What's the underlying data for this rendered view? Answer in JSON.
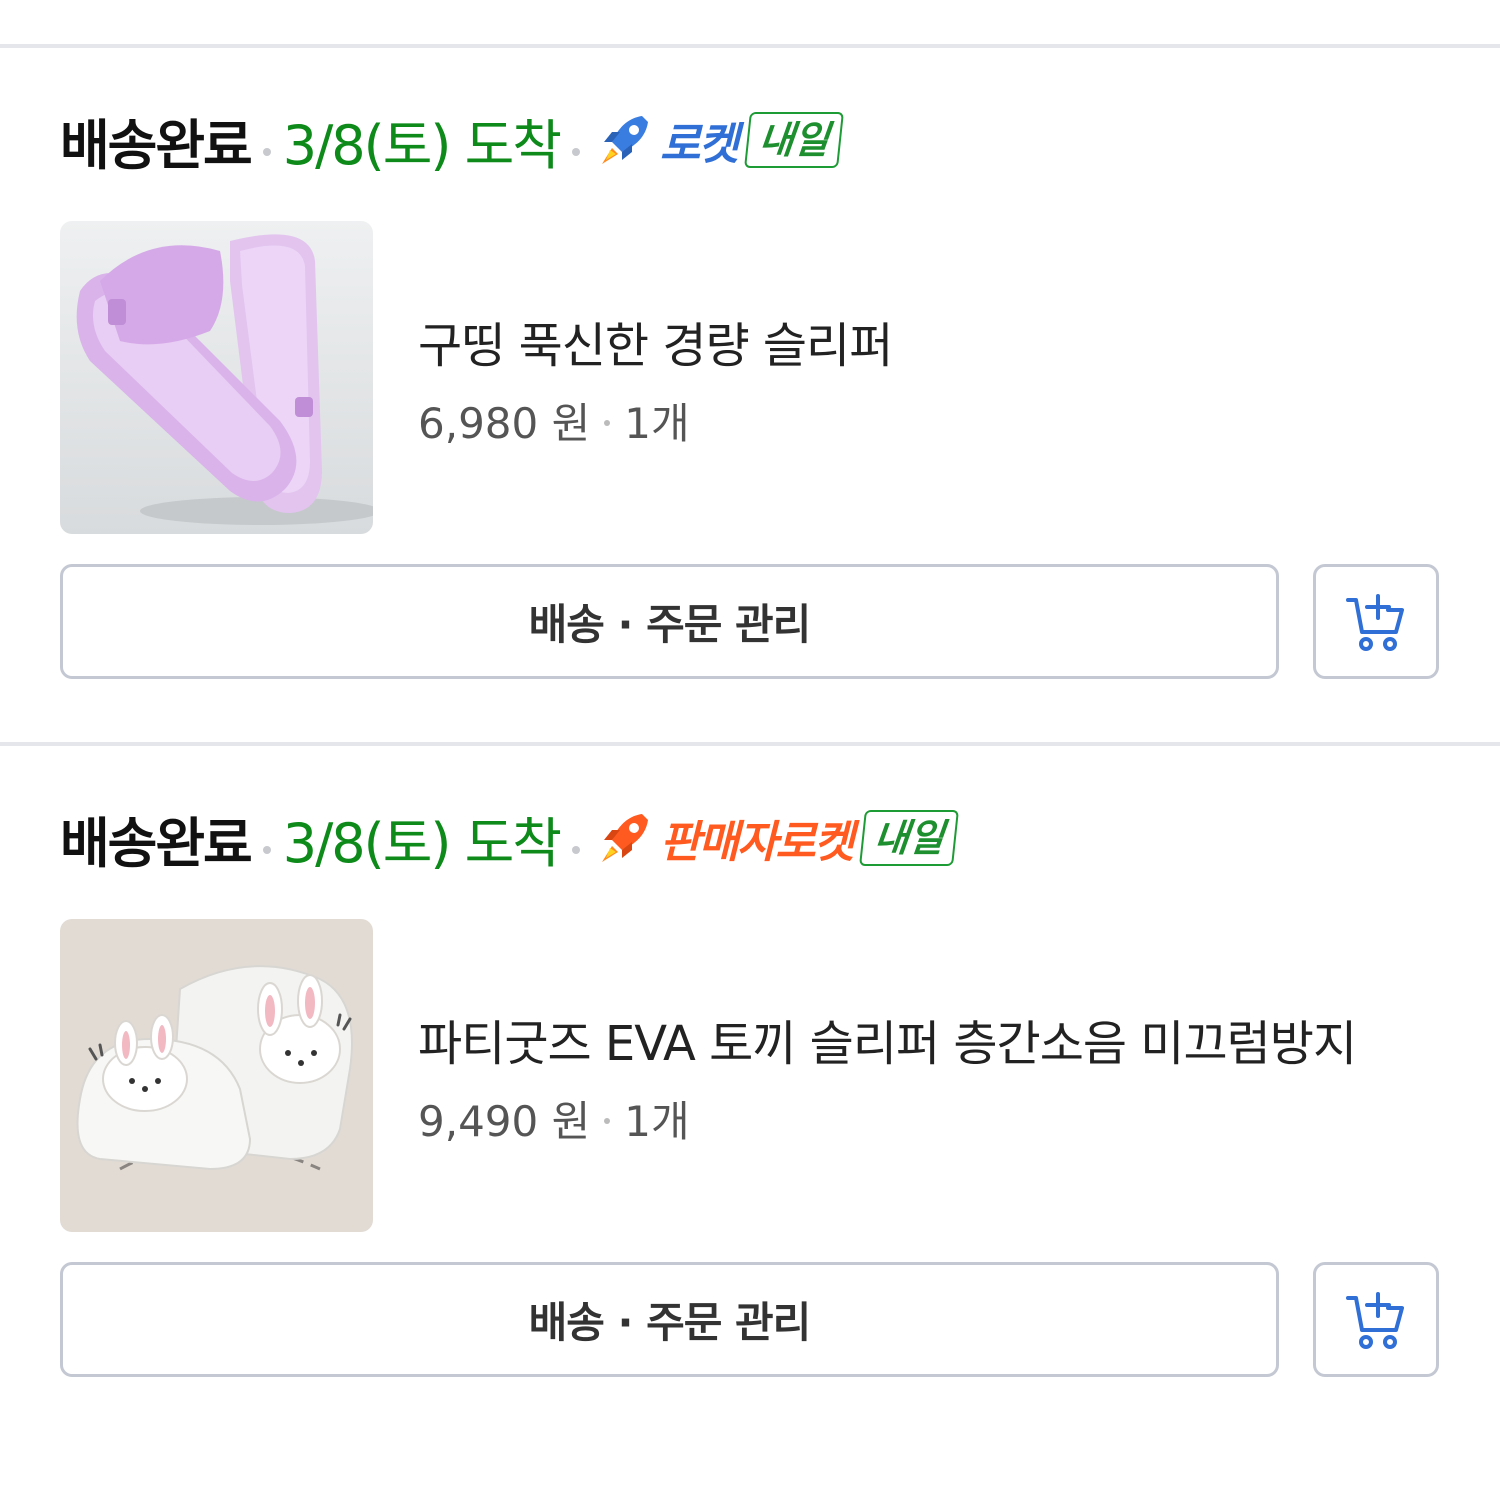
{
  "orders": [
    {
      "status": "배송완료",
      "arrival": "3/8(토) 도착",
      "delivery_brand": "로켓",
      "delivery_badge": "내일",
      "product_name": "구띵 푹신한 경량 슬리퍼",
      "price": "6,980 원",
      "quantity": "1개",
      "manage_label": "배송 · 주문 관리",
      "product_image": "pink-slide-slippers-photo",
      "cart_icon": "add-to-cart-icon",
      "brand_color": "#2f6fd6"
    },
    {
      "status": "배송완료",
      "arrival": "3/8(토) 도착",
      "delivery_brand": "판매자로켓",
      "delivery_badge": "내일",
      "product_name": "파티굿즈 EVA 토끼 슬리퍼 층간소음 미끄럼방지",
      "price": "9,490 원",
      "quantity": "1개",
      "manage_label": "배송 · 주문 관리",
      "product_image": "white-bunny-slippers-photo",
      "cart_icon": "add-to-cart-icon",
      "brand_color": "#ff5a1f"
    }
  ],
  "colors": {
    "arrival_green": "#0d8a1a",
    "divider": "#e4e6eb",
    "button_border": "#c3c8d2",
    "cart_icon_blue": "#2f6fd6"
  }
}
